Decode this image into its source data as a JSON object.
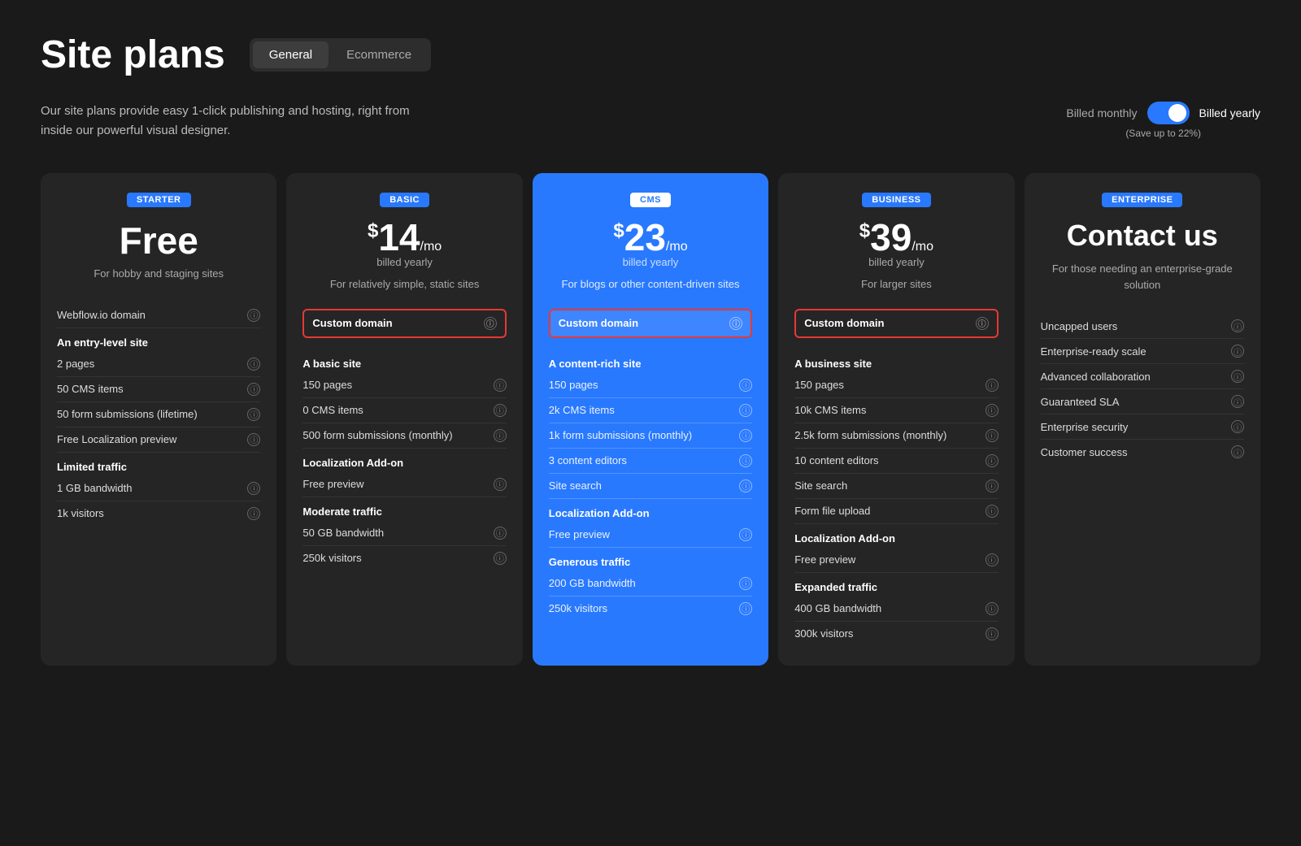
{
  "page": {
    "title": "Site plans",
    "subtitle": "Our site plans provide easy 1-click publishing and hosting, right from inside our powerful visual designer."
  },
  "tabs": [
    {
      "label": "General",
      "active": true
    },
    {
      "label": "Ecommerce",
      "active": false
    }
  ],
  "billing": {
    "monthly_label": "Billed monthly",
    "yearly_label": "Billed yearly",
    "save_label": "(Save up to 22%)"
  },
  "plans": [
    {
      "id": "starter",
      "badge": "STARTER",
      "price": "Free",
      "price_is_free": true,
      "billed": "",
      "desc": "For hobby and staging sites",
      "highlight_domain": false,
      "features": [
        {
          "type": "row",
          "text": "Webflow.io domain",
          "info": true
        },
        {
          "type": "heading",
          "text": "An entry-level site"
        },
        {
          "type": "row",
          "text": "2 pages",
          "info": true
        },
        {
          "type": "row",
          "text": "50 CMS items",
          "info": true
        },
        {
          "type": "row",
          "text": "50 form submissions (lifetime)",
          "info": true
        },
        {
          "type": "row",
          "text": "Free Localization preview",
          "info": true
        },
        {
          "type": "heading",
          "text": "Limited traffic"
        },
        {
          "type": "row",
          "text": "1 GB bandwidth",
          "info": true
        },
        {
          "type": "row",
          "text": "1k visitors",
          "info": true
        }
      ]
    },
    {
      "id": "basic",
      "badge": "BASIC",
      "price": "$14",
      "price_suffix": "/mo",
      "billed": "billed yearly",
      "desc": "For relatively simple, static sites",
      "highlight_domain": true,
      "features": [
        {
          "type": "heading",
          "text": "A basic site"
        },
        {
          "type": "row",
          "text": "150 pages",
          "info": true
        },
        {
          "type": "row",
          "text": "0 CMS items",
          "info": true
        },
        {
          "type": "row",
          "text": "500 form submissions (monthly)",
          "info": true
        },
        {
          "type": "heading",
          "text": "Localization Add-on"
        },
        {
          "type": "row",
          "text": "Free preview",
          "info": true
        },
        {
          "type": "heading",
          "text": "Moderate traffic"
        },
        {
          "type": "row",
          "text": "50 GB bandwidth",
          "info": true
        },
        {
          "type": "row",
          "text": "250k visitors",
          "info": true
        }
      ]
    },
    {
      "id": "cms",
      "badge": "CMS",
      "price": "$23",
      "price_suffix": "/mo",
      "billed": "billed yearly",
      "desc": "For blogs or other content-driven sites",
      "highlight_domain": true,
      "is_featured": true,
      "features": [
        {
          "type": "heading",
          "text": "A content-rich site",
          "blue": true
        },
        {
          "type": "row",
          "text": "150 pages",
          "info": true
        },
        {
          "type": "row",
          "text": "2k CMS items",
          "info": true
        },
        {
          "type": "row",
          "text": "1k form submissions (monthly)",
          "info": true
        },
        {
          "type": "row",
          "text": "3 content editors",
          "info": true
        },
        {
          "type": "row",
          "text": "Site search",
          "info": true
        },
        {
          "type": "heading",
          "text": "Localization Add-on",
          "blue": true
        },
        {
          "type": "row",
          "text": "Free preview",
          "info": true
        },
        {
          "type": "heading",
          "text": "Generous traffic",
          "blue": true
        },
        {
          "type": "row",
          "text": "200 GB bandwidth",
          "info": true
        },
        {
          "type": "row",
          "text": "250k visitors",
          "info": true
        }
      ]
    },
    {
      "id": "business",
      "badge": "BUSINESS",
      "price": "$39",
      "price_suffix": "/mo",
      "billed": "billed yearly",
      "desc": "For larger sites",
      "highlight_domain": true,
      "features": [
        {
          "type": "heading",
          "text": "A business site"
        },
        {
          "type": "row",
          "text": "150 pages",
          "info": true
        },
        {
          "type": "row",
          "text": "10k CMS items",
          "info": true
        },
        {
          "type": "row",
          "text": "2.5k form submissions (monthly)",
          "info": true
        },
        {
          "type": "row",
          "text": "10 content editors",
          "info": true
        },
        {
          "type": "row",
          "text": "Site search",
          "info": true
        },
        {
          "type": "row",
          "text": "Form file upload",
          "info": true
        },
        {
          "type": "heading",
          "text": "Localization Add-on"
        },
        {
          "type": "row",
          "text": "Free preview",
          "info": true
        },
        {
          "type": "heading",
          "text": "Expanded traffic"
        },
        {
          "type": "row",
          "text": "400 GB bandwidth",
          "info": true
        },
        {
          "type": "row",
          "text": "300k visitors",
          "info": true
        }
      ]
    },
    {
      "id": "enterprise",
      "badge": "ENTERPRISE",
      "price": "Contact us",
      "price_is_contact": true,
      "billed": "",
      "desc": "For those needing an enterprise-grade solution",
      "highlight_domain": false,
      "features": [
        {
          "type": "row",
          "text": "Uncapped users",
          "info": true
        },
        {
          "type": "row",
          "text": "Enterprise-ready scale",
          "info": true
        },
        {
          "type": "row",
          "text": "Advanced collaboration",
          "info": true
        },
        {
          "type": "row",
          "text": "Guaranteed SLA",
          "info": true
        },
        {
          "type": "row",
          "text": "Enterprise security",
          "info": true
        },
        {
          "type": "row",
          "text": "Customer success",
          "info": true
        }
      ]
    }
  ]
}
